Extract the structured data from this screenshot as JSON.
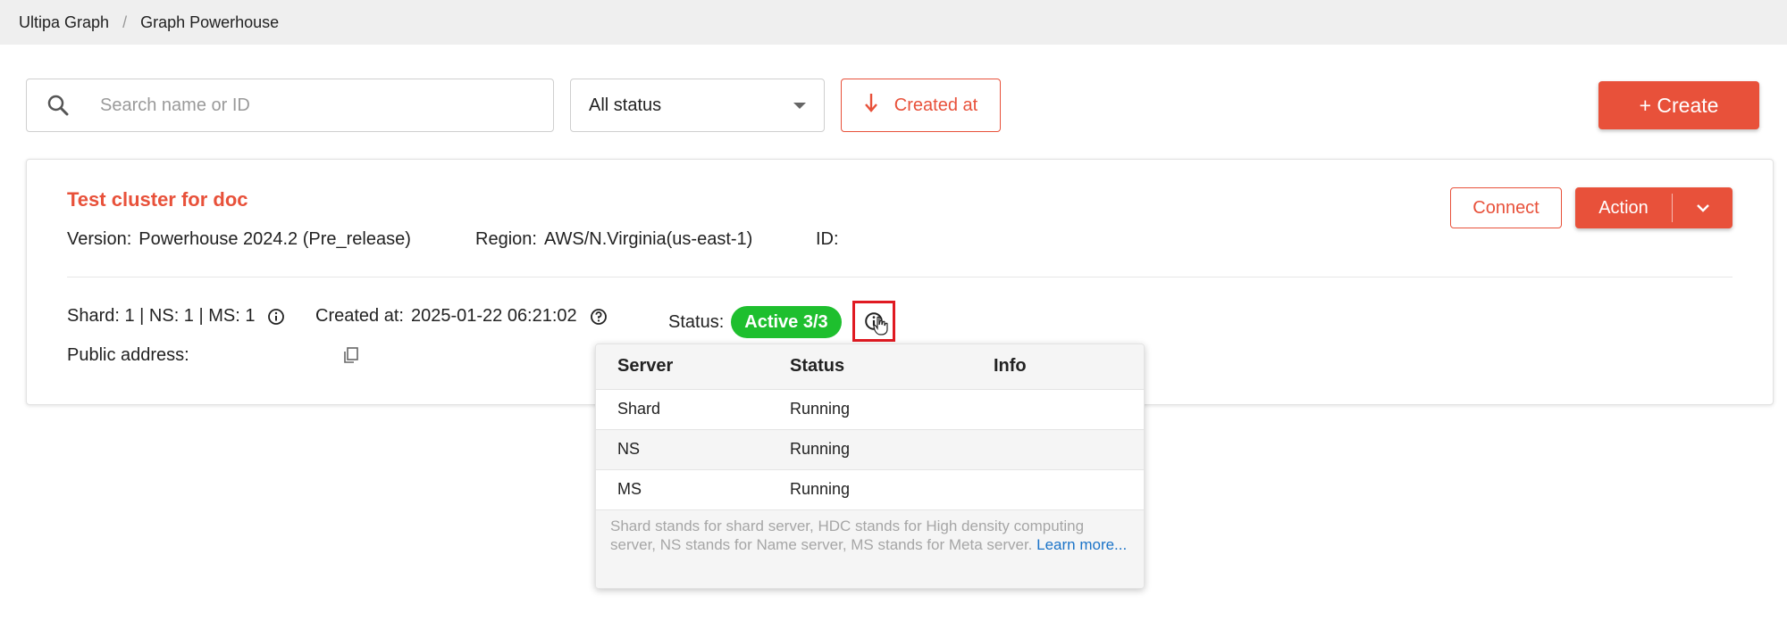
{
  "breadcrumb": {
    "items": [
      "Ultipa Graph",
      "Graph Powerhouse"
    ],
    "separator": "/"
  },
  "toolbar": {
    "search_placeholder": "Search name or ID",
    "search_value": "",
    "status_filter": "All status",
    "sort_label": "Created at",
    "create_label": "+ Create"
  },
  "cluster": {
    "name": "Test cluster for doc",
    "version_label": "Version:",
    "version_value": "Powerhouse 2024.2 (Pre_release)",
    "region_label": "Region:",
    "region_value": "AWS/N.Virginia(us-east-1)",
    "id_label": "ID:",
    "id_value": "",
    "connect_label": "Connect",
    "action_label": "Action",
    "nodes_summary": "Shard: 1 | NS: 1 | MS: 1",
    "created_label": "Created at:",
    "created_value": "2025-01-22 06:21:02",
    "status_label": "Status:",
    "status_badge": "Active 3/3",
    "public_address_label": "Public address:",
    "public_address_value": ""
  },
  "status_popup": {
    "headers": [
      "Server",
      "Status",
      "Info"
    ],
    "rows": [
      {
        "server": "Shard",
        "status": "Running",
        "info": ""
      },
      {
        "server": "NS",
        "status": "Running",
        "info": ""
      },
      {
        "server": "MS",
        "status": "Running",
        "info": ""
      }
    ],
    "note": "Shard stands for shard server, HDC stands for High density computing server, NS stands for Name server, MS stands for Meta server.",
    "learn_more": "Learn more..."
  },
  "colors": {
    "accent": "#e8513a",
    "active_badge": "#1ebf2e",
    "highlight": "#e01a22",
    "link": "#1a73c8"
  },
  "icons": [
    "search-icon",
    "chevron-down-icon",
    "arrow-down-icon",
    "info-icon",
    "help-icon",
    "copy-icon",
    "cursor-hand-icon"
  ]
}
